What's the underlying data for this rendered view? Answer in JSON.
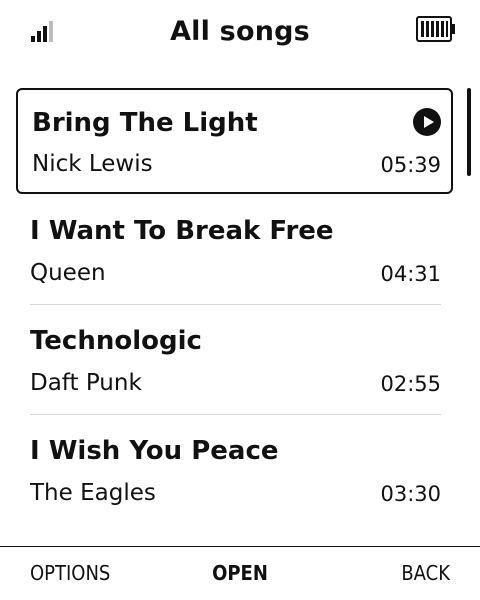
{
  "header": {
    "title": "All songs",
    "signal_icon": "signal-strength-icon",
    "battery_icon": "battery-full-icon"
  },
  "songs": [
    {
      "title": "Bring The Light",
      "artist": "Nick Lewis",
      "duration": "05:39",
      "selected": true,
      "icon": "play-icon"
    },
    {
      "title": "I Want To Break Free",
      "artist": "Queen",
      "duration": "04:31",
      "selected": false
    },
    {
      "title": "Technologic",
      "artist": "Daft Punk",
      "duration": "02:55",
      "selected": false
    },
    {
      "title": "I Wish You Peace",
      "artist": "The Eagles",
      "duration": "03:30",
      "selected": false
    }
  ],
  "softkeys": {
    "left": "OPTIONS",
    "center": "OPEN",
    "right": "BACK"
  }
}
